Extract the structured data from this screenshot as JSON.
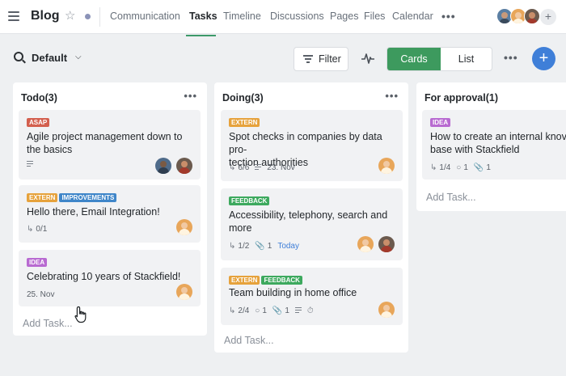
{
  "header": {
    "title": "Blog",
    "tabs": [
      {
        "label": "Communication",
        "active": false
      },
      {
        "label": "Tasks",
        "active": true
      },
      {
        "label": "Timeline",
        "active": false
      },
      {
        "label": "Discussions",
        "active": false
      },
      {
        "label": "Pages",
        "active": false
      },
      {
        "label": "Files",
        "active": false
      },
      {
        "label": "Calendar",
        "active": false
      }
    ],
    "more": "•••",
    "add_member": "+"
  },
  "toolbar": {
    "view_label": "Default",
    "filter_label": "Filter",
    "cards_label": "Cards",
    "list_label": "List",
    "more": "•••",
    "add": "+"
  },
  "colors": {
    "accent_green": "#3d9a5e",
    "accent_blue": "#3f7fd8",
    "tag_asap": "#d35f4e",
    "tag_extern": "#e6a23c",
    "tag_improvements": "#3f86c9",
    "tag_idea": "#b86ad1",
    "tag_feedback": "#3da95e"
  },
  "columns": [
    {
      "title": "Todo(3)",
      "more": "•••",
      "add_task": "Add Task...",
      "cards": [
        {
          "tags": [
            "ASAP"
          ],
          "title_lines": [
            "Agile project management down to",
            "the basics"
          ],
          "meta": {
            "description": true
          }
        },
        {
          "tags": [
            "EXTERN",
            "IMPROVEMENTS"
          ],
          "title_lines": [
            "Hello there, Email Integration!"
          ],
          "meta": {
            "subtasks": "0/1"
          }
        },
        {
          "tags": [
            "IDEA"
          ],
          "title_lines": [
            "Celebrating 10 years of Stackfield!"
          ],
          "meta": {
            "date": "25. Nov"
          }
        }
      ]
    },
    {
      "title": "Doing(3)",
      "more": "•••",
      "add_task": "Add Task...",
      "cards": [
        {
          "tags": [
            "EXTERN"
          ],
          "title_lines": [
            "Spot checks in companies by data pro-",
            "tection authorities"
          ],
          "meta": {
            "subtasks": "6/6",
            "date": "23. Nov"
          }
        },
        {
          "tags": [
            "FEEDBACK"
          ],
          "title_lines": [
            "Accessibility, telephony, search and",
            "more"
          ],
          "meta": {
            "subtasks": "1/2",
            "attachments": "1",
            "due": "Today"
          }
        },
        {
          "tags": [
            "EXTERN",
            "FEEDBACK"
          ],
          "title_lines": [
            "Team building in home office"
          ],
          "meta": {
            "subtasks": "2/4",
            "comments": "1",
            "attachments": "1"
          }
        }
      ]
    },
    {
      "title": "For approval(1)",
      "more": "",
      "add_task": "Add Task...",
      "cards": [
        {
          "tags": [
            "IDEA"
          ],
          "title_lines": [
            "How to create an internal knov",
            "base with Stackfield"
          ],
          "meta": {
            "subtasks": "1/4",
            "comments": "1",
            "attachments": "1"
          }
        }
      ]
    }
  ]
}
